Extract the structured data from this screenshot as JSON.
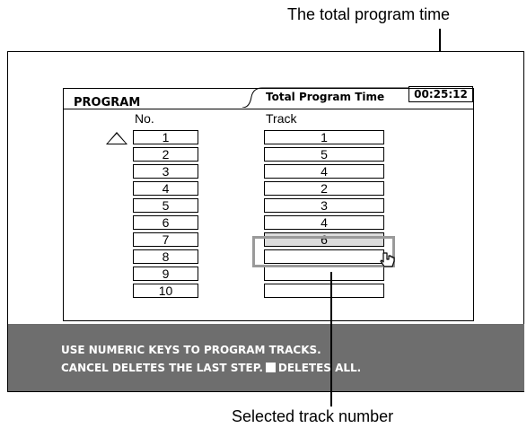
{
  "callouts": {
    "top": "The total program time",
    "bottom": "Selected track number"
  },
  "panel": {
    "tab_title": "PROGRAM",
    "total_program_time_label": "Total Program Time",
    "total_program_time_value": "00:25:12",
    "col_no": "No.",
    "col_track": "Track"
  },
  "rows": [
    {
      "no": "1",
      "track": "1"
    },
    {
      "no": "2",
      "track": "5"
    },
    {
      "no": "3",
      "track": "4"
    },
    {
      "no": "4",
      "track": "2"
    },
    {
      "no": "5",
      "track": "3"
    },
    {
      "no": "6",
      "track": "4"
    },
    {
      "no": "7",
      "track": "6"
    },
    {
      "no": "8",
      "track": ""
    },
    {
      "no": "9",
      "track": ""
    },
    {
      "no": "10",
      "track": ""
    }
  ],
  "selected_row": "7",
  "info": {
    "line1": "USE NUMERIC KEYS  TO PROGRAM TRACKS.",
    "line2_pre": "CANCEL DELETES THE LAST STEP.",
    "line2_post": "DELETES ALL."
  },
  "icons": {
    "cursor": "up-triangle-icon",
    "pointer": "hand-pointer-icon",
    "stop": "stop-square-icon"
  },
  "colors": {
    "info_bar": "#6e6e6e",
    "selected_fill": "#dcdcdc",
    "selected_frame": "#9a9a9a"
  }
}
